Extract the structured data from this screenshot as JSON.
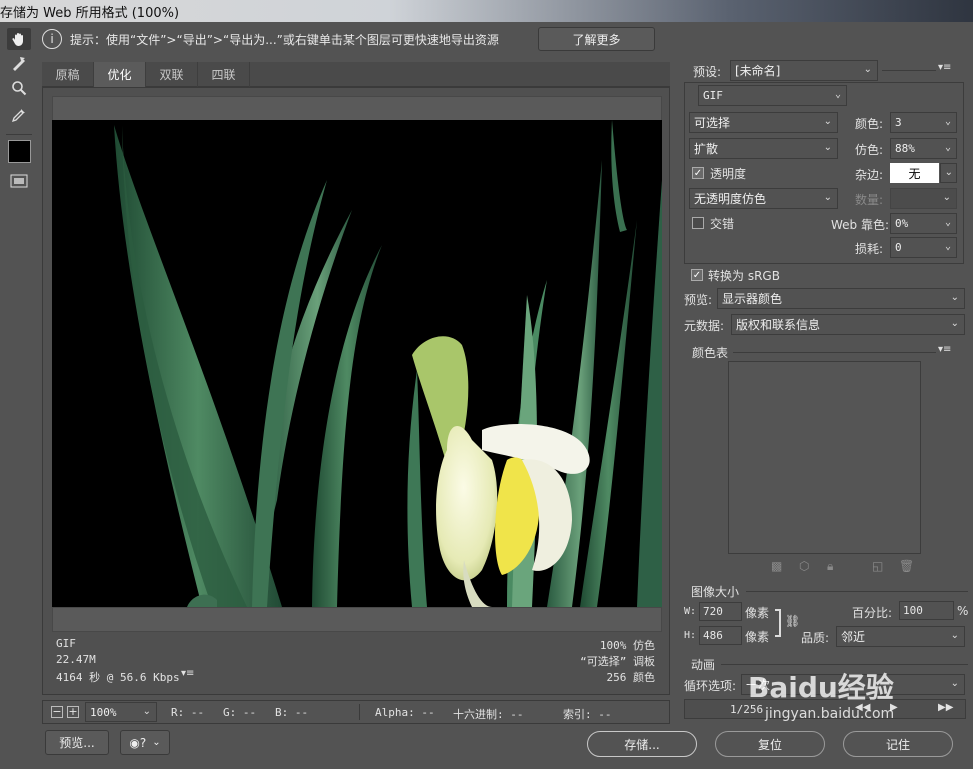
{
  "window": {
    "title": "存储为 Web 所用格式 (100%)"
  },
  "tip": {
    "text": "提示：使用“文件”>“导出”>“导出为...”或右键单击某个图层可更快速地导出资源",
    "learn_more": "了解更多"
  },
  "tabs": [
    "原稿",
    "优化",
    "双联",
    "四联"
  ],
  "info": {
    "format": "GIF",
    "size": "22.47M",
    "time": "4164 秒 @ 56.6 Kbps",
    "dither": "100% 仿色",
    "palette": "“可选择” 调板",
    "colors": "256 颜色"
  },
  "status": {
    "zoom": "100%",
    "r": "R: --",
    "g": "G: --",
    "b": "B: --",
    "alpha": "Alpha: --",
    "hex": "十六进制: --",
    "index": "索引: --"
  },
  "bottom": {
    "preview": "预览...",
    "save": "存储...",
    "reset": "复位",
    "remember": "记住"
  },
  "settings": {
    "preset_label": "预设:",
    "preset_value": "[未命名]",
    "format": "GIF",
    "reduction": "可选择",
    "colors_label": "颜色:",
    "colors_value": "3",
    "dither_algo": "扩散",
    "dither_label": "仿色:",
    "dither_value": "88%",
    "transparency": "透明度",
    "matte_label": "杂边:",
    "matte_value": "无",
    "trans_dither": "无透明度仿色",
    "amount_label": "数量:",
    "interlace": "交错",
    "websnap_label": "Web 靠色:",
    "websnap_value": "0%",
    "lossy_label": "损耗:",
    "lossy_value": "0",
    "srgb": "转换为 sRGB",
    "preview_label": "预览:",
    "preview_value": "显示器颜色",
    "metadata_label": "元数据:",
    "metadata_value": "版权和联系信息"
  },
  "colortable": {
    "title": "颜色表"
  },
  "imagesize": {
    "title": "图像大小",
    "w_label": "W:",
    "w_value": "720",
    "h_label": "H:",
    "h_value": "486",
    "unit": "像素",
    "percent_label": "百分比:",
    "percent_value": "100",
    "percent_unit": "%",
    "quality_label": "品质:",
    "quality_value": "邻近"
  },
  "animation": {
    "title": "动画",
    "loop_label": "循环选项:",
    "loop_value": "一次",
    "frame": "1/256"
  },
  "watermark": {
    "brand": "Baidu经验",
    "url": "jingyan.baidu.com"
  }
}
